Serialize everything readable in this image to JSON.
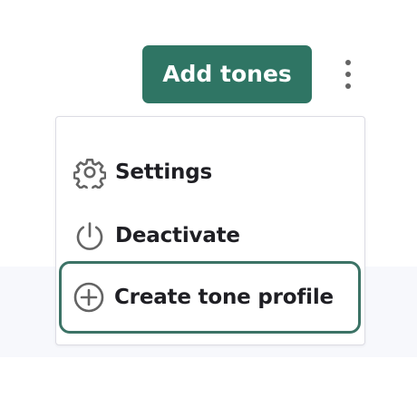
{
  "header": {
    "add_tones_label": "Add tones",
    "more_icon": "more-vertical-icon"
  },
  "menu": {
    "items": [
      {
        "label": "Settings",
        "icon": "gear-icon"
      },
      {
        "label": "Deactivate",
        "icon": "power-icon"
      },
      {
        "label": "Create tone profile",
        "icon": "plus-circle-icon"
      }
    ]
  },
  "colors": {
    "primary": "#2f7564",
    "focus_outline": "#3c7366",
    "text": "#1f1f24",
    "icon": "#646464",
    "background_band": "#f7f8fc"
  }
}
